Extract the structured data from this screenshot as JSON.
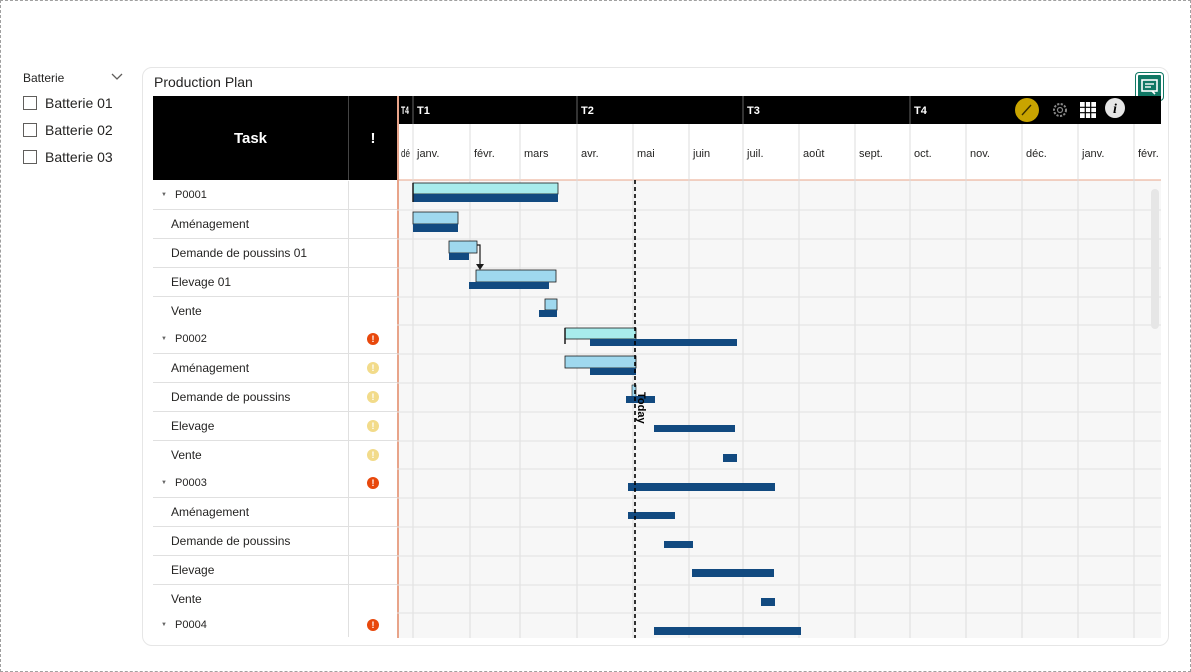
{
  "slicer": {
    "title": "Batterie",
    "items": [
      {
        "label": "Batterie 01"
      },
      {
        "label": "Batterie 02"
      },
      {
        "label": "Batterie 03"
      }
    ]
  },
  "visual": {
    "title": "Production Plan",
    "header": {
      "task": "Task",
      "flag": "!"
    },
    "toolbar": [
      "pencil-icon",
      "gear-icon",
      "grid-icon",
      "info-icon"
    ],
    "today_label": "Today"
  },
  "colors": {
    "header_bg": "#000000",
    "plan_bar": "#9fd8ee",
    "plan_bar_group": "#a8ecec",
    "actual_bar": "#124a80",
    "flag_red": "#e8480c",
    "flag_yellow": "#f2db8a",
    "focus_button": "#117865",
    "toolbar_pencil": "#c9a400",
    "axis_line": "#e8a48a"
  },
  "timeline": {
    "quarters": [
      {
        "label": "T4"
      },
      {
        "label": "T1"
      },
      {
        "label": "T2"
      },
      {
        "label": "T3"
      },
      {
        "label": "T4"
      }
    ],
    "months": [
      "dé",
      "janv.",
      "févr.",
      "mars",
      "avr.",
      "mai",
      "juin",
      "juil.",
      "août",
      "sept.",
      "oct.",
      "nov.",
      "déc.",
      "janv.",
      "févr."
    ]
  },
  "rows": [
    {
      "label": "P0001",
      "group": true,
      "flag": ""
    },
    {
      "label": "Aménagement",
      "group": false,
      "flag": ""
    },
    {
      "label": "Demande de poussins 01",
      "group": false,
      "flag": ""
    },
    {
      "label": "Elevage 01",
      "group": false,
      "flag": ""
    },
    {
      "label": "Vente",
      "group": false,
      "flag": ""
    },
    {
      "label": "P0002",
      "group": true,
      "flag": "red"
    },
    {
      "label": "Aménagement",
      "group": false,
      "flag": "yellow"
    },
    {
      "label": "Demande de poussins",
      "group": false,
      "flag": "yellow"
    },
    {
      "label": "Elevage",
      "group": false,
      "flag": "yellow"
    },
    {
      "label": "Vente",
      "group": false,
      "flag": "yellow"
    },
    {
      "label": "P0003",
      "group": true,
      "flag": "red"
    },
    {
      "label": "Aménagement",
      "group": false,
      "flag": ""
    },
    {
      "label": "Demande de poussins",
      "group": false,
      "flag": ""
    },
    {
      "label": "Elevage",
      "group": false,
      "flag": ""
    },
    {
      "label": "Vente",
      "group": false,
      "flag": ""
    },
    {
      "label": "P0004",
      "group": true,
      "flag": "red"
    }
  ]
}
